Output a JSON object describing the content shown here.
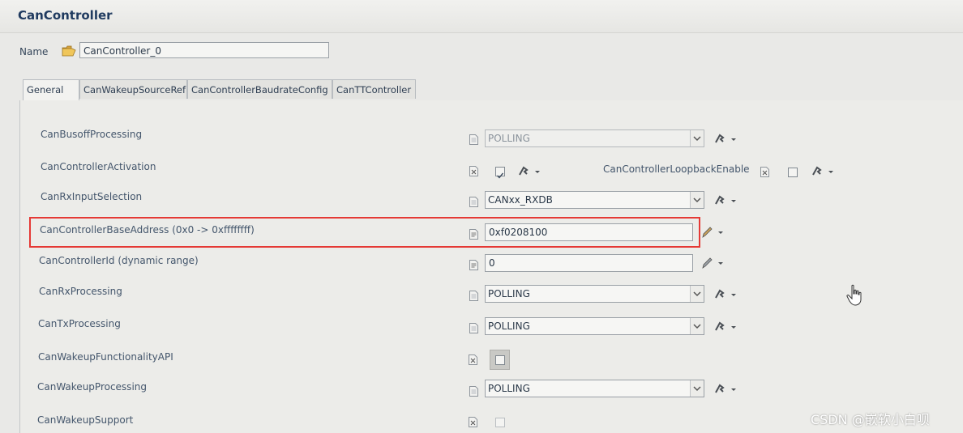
{
  "window": {
    "title": "CanController"
  },
  "name_field": {
    "label": "Name",
    "value": "CanController_0",
    "icon": "folder-open-icon"
  },
  "tabs": [
    {
      "label": "General",
      "active": true
    },
    {
      "label": "CanWakeupSourceRef",
      "active": false
    },
    {
      "label": "CanControllerBaudrateConfig",
      "active": false
    },
    {
      "label": "CanTTController",
      "active": false
    }
  ],
  "rows": {
    "busoff": {
      "label": "CanBusoffProcessing",
      "value": "POLLING",
      "disabled": true
    },
    "activation": {
      "label": "CanControllerActivation",
      "checked": true,
      "loopback_label": "CanControllerLoopbackEnable",
      "loopback_checked": false
    },
    "rxinput": {
      "label": "CanRxInputSelection",
      "value": "CANxx_RXDB"
    },
    "baseaddr": {
      "label": "CanControllerBaseAddress (0x0 -> 0xffffffff)",
      "value": "0xf0208100",
      "highlighted": true
    },
    "ctrlid": {
      "label": "CanControllerId (dynamic range)",
      "value": "0"
    },
    "rxproc": {
      "label": "CanRxProcessing",
      "value": "POLLING"
    },
    "txproc": {
      "label": "CanTxProcessing",
      "value": "POLLING"
    },
    "wakeupapi": {
      "label": "CanWakeupFunctionalityAPI",
      "checked": false
    },
    "wakeupproc": {
      "label": "CanWakeupProcessing",
      "value": "POLLING"
    },
    "wakeupsupport": {
      "label": "CanWakeupSupport",
      "checked": false
    }
  },
  "watermark": "CSDN @嵌软小白呗",
  "colors": {
    "accent_red": "#e53935",
    "title": "#1f3a5f",
    "label": "#44566c"
  }
}
